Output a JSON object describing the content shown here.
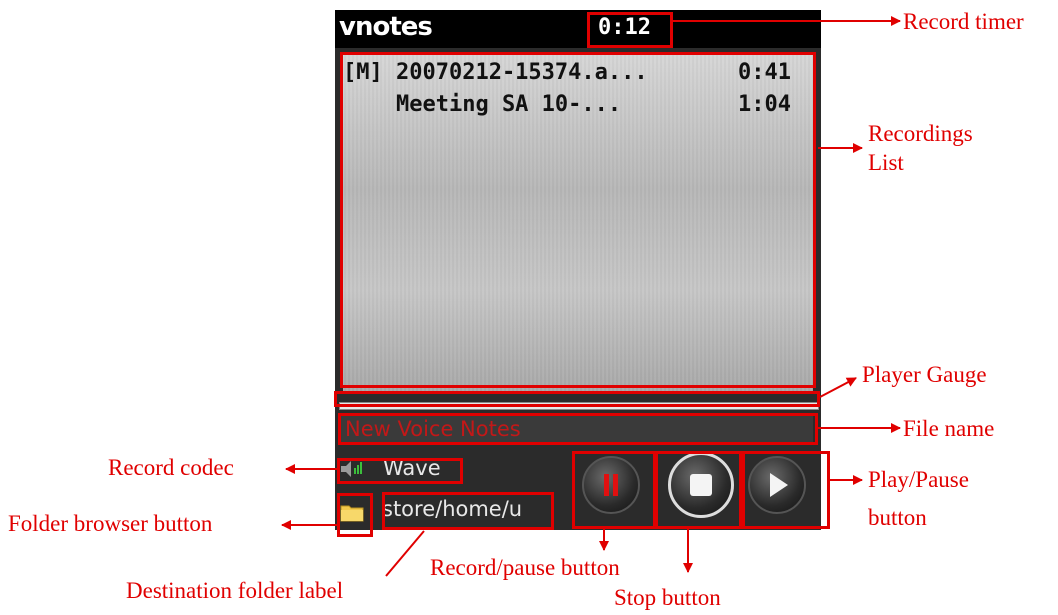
{
  "app": {
    "title": "vnotes",
    "timer": "0:12"
  },
  "recordings": [
    {
      "name": "[M] 20070212-15374.a...",
      "duration": "0:41"
    },
    {
      "name": "    Meeting SA 10-...",
      "duration": "1:04"
    }
  ],
  "player": {
    "file_name": "New Voice Notes",
    "codec": "Wave",
    "destination_folder": "store/home/u",
    "gauge_progress": 0
  },
  "annotations": {
    "record_timer": "Record timer",
    "recordings_list_line1": "Recordings",
    "recordings_list_line2": "List",
    "player_gauge": "Player Gauge",
    "file_name": "File name",
    "record_codec": "Record codec",
    "folder_browser": "Folder browser button",
    "play_pause_line1": "Play/Pause",
    "play_pause_line2": "button",
    "record_pause": "Record/pause button",
    "stop_button": "Stop button",
    "destination_folder": "Destination folder label"
  },
  "colors": {
    "annotation": "#e00000",
    "file_name_text": "#c21818",
    "codec_icon": "#3cbf3c"
  }
}
